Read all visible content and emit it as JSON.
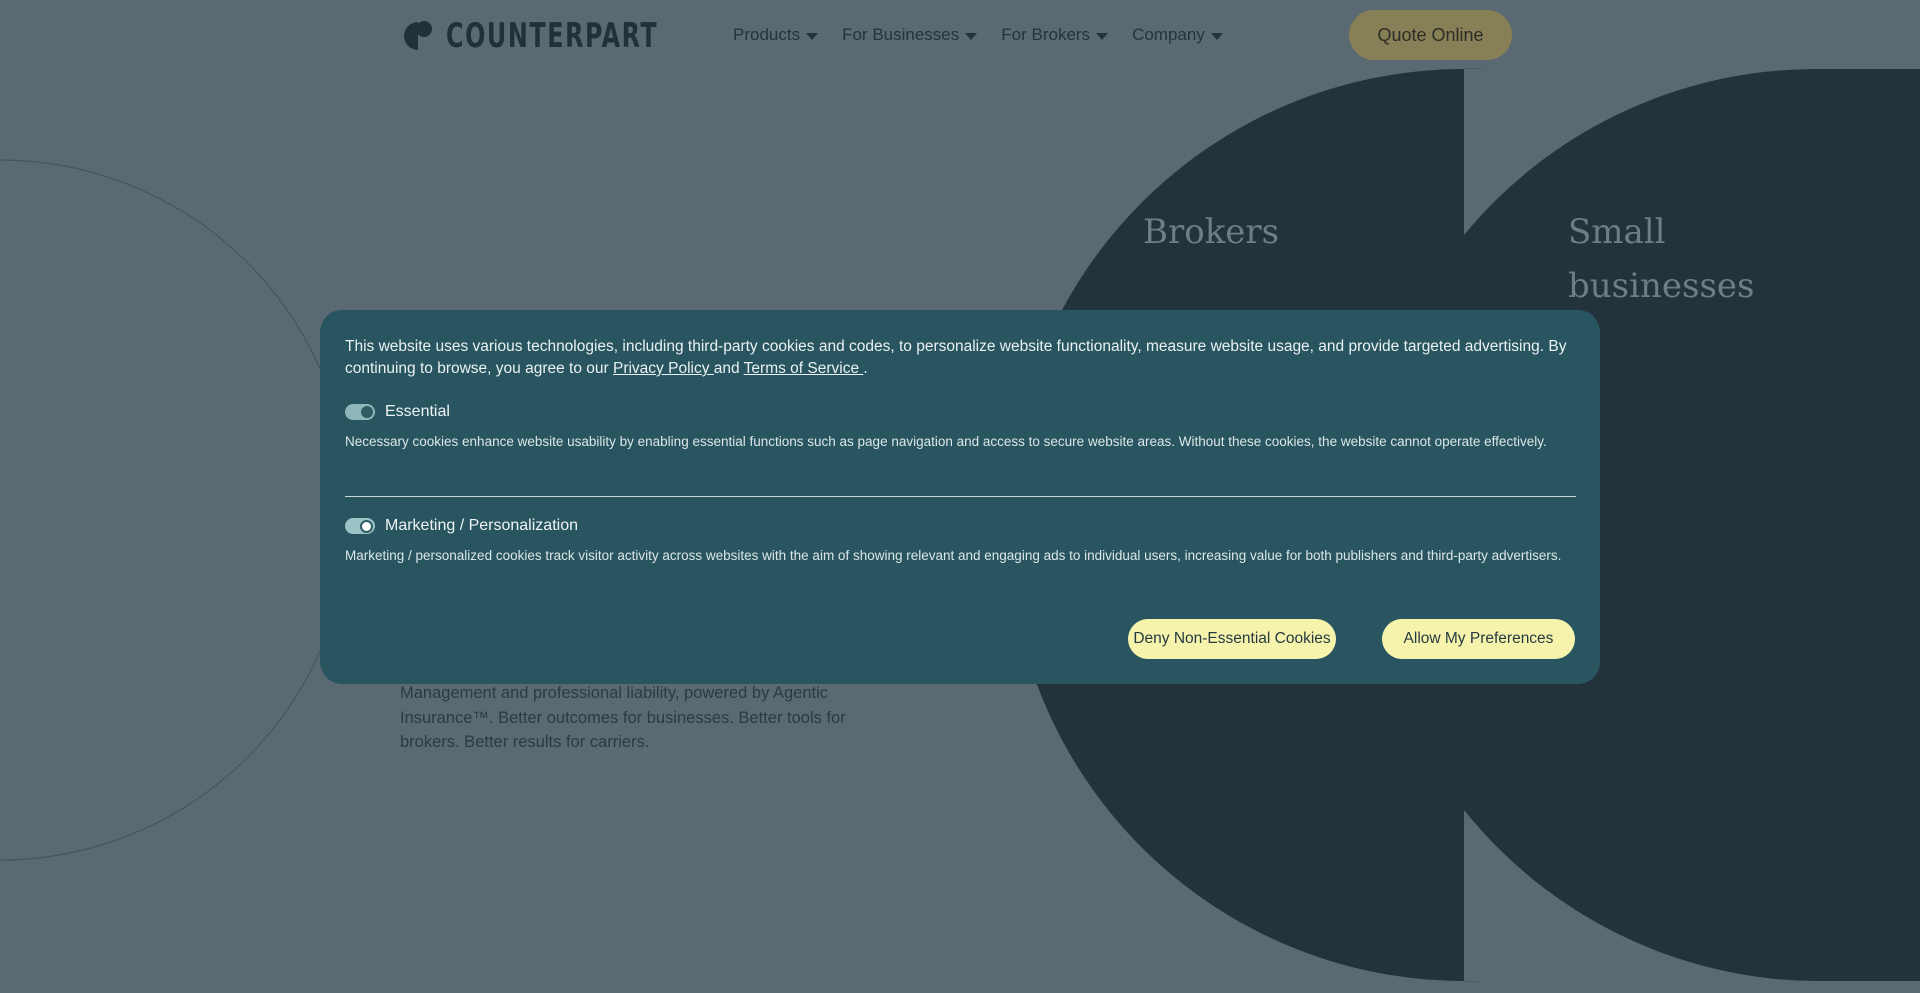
{
  "header": {
    "logo_text": "COUNTERPART",
    "nav": [
      {
        "label": "Products"
      },
      {
        "label": "For Businesses"
      },
      {
        "label": "For Brokers"
      },
      {
        "label": "Company"
      }
    ],
    "quote_button": "Quote Online"
  },
  "panels": {
    "brokers_title": "Brokers",
    "small_business_title_line1": "Small",
    "small_business_title_line2": "businesses"
  },
  "hero": {
    "text_line1": "Management and professional liability, powered by Agentic",
    "text_line2": "Insurance™. Better outcomes for businesses. Better tools for",
    "text_line3": "brokers. Better results for carriers."
  },
  "cookie": {
    "intro_text_1": "This website uses various technologies, including third-party cookies and codes, to personalize website functionality, measure website usage, and provide targeted advertising. By continuing to browse, you agree to our ",
    "privacy_link": "Privacy Policy ",
    "and_text": " and ",
    "terms_link": "Terms of Service ",
    "intro_end": ".",
    "essential_label": "Essential",
    "essential_desc": "Necessary cookies enhance website usability by enabling essential functions such as page navigation and access to secure website areas. Without these cookies, the website cannot operate effectively.",
    "marketing_label": "Marketing / Personalization",
    "marketing_desc": "Marketing / personalized cookies track visitor activity across websites with the aim of showing relevant and engaging ads to individual users, increasing value for both publishers and third-party advertisers.",
    "deny_button": "Deny Non-Essential Cookies",
    "allow_button": "Allow My Preferences"
  },
  "colors": {
    "background": "#5b6a72",
    "dark_panel": "#22333c",
    "modal": "#295560",
    "button_yellow": "#f6f3ac",
    "quote_button": "#877f55"
  }
}
